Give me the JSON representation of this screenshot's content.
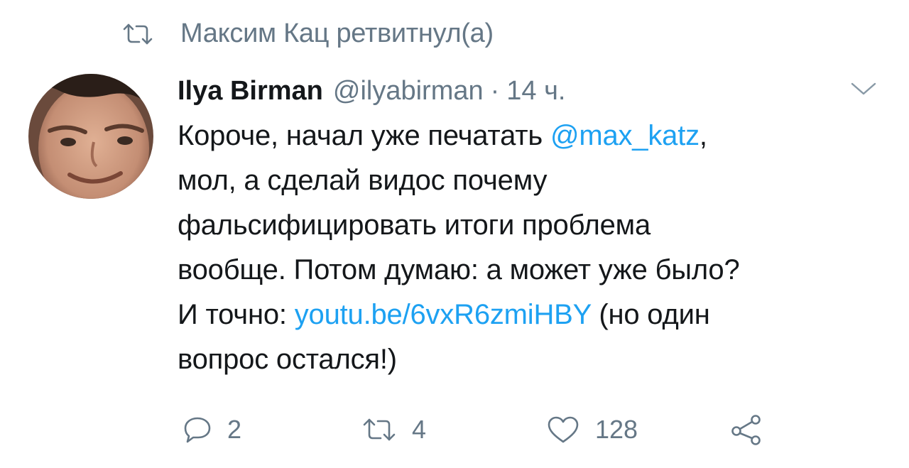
{
  "retweet_header": {
    "text": "Максим Кац ретвитнул(а)",
    "icon": "retweet-icon"
  },
  "author": {
    "display_name": "Ilya Birman",
    "handle": "@ilyabirman",
    "separator": "·",
    "time": "14 ч.",
    "avatar": "avatar-photo"
  },
  "menu": {
    "icon": "chevron-down-icon"
  },
  "body": {
    "line1_text": "Короче, начал уже печатать ",
    "line1_mention": "@max_katz",
    "line1_after": ",",
    "line2": "мол, а сделай видос почему",
    "line3": "фальсифицировать итоги проблема",
    "line4": "вообще. Потом думаю: а может уже было?",
    "line5_before": "И точно: ",
    "line5_link": "youtu.be/6vxR6zmiHBY",
    "line5_after": " (но один",
    "line6": "вопрос остался!)"
  },
  "actions": {
    "reply": {
      "icon": "reply-icon",
      "count": "2"
    },
    "retweet": {
      "icon": "retweet-icon",
      "count": "4"
    },
    "like": {
      "icon": "heart-icon",
      "count": "128"
    },
    "share": {
      "icon": "share-icon"
    }
  },
  "colors": {
    "text": "#14171a",
    "secondary": "#657786",
    "link": "#1da1f2",
    "background": "#ffffff"
  }
}
